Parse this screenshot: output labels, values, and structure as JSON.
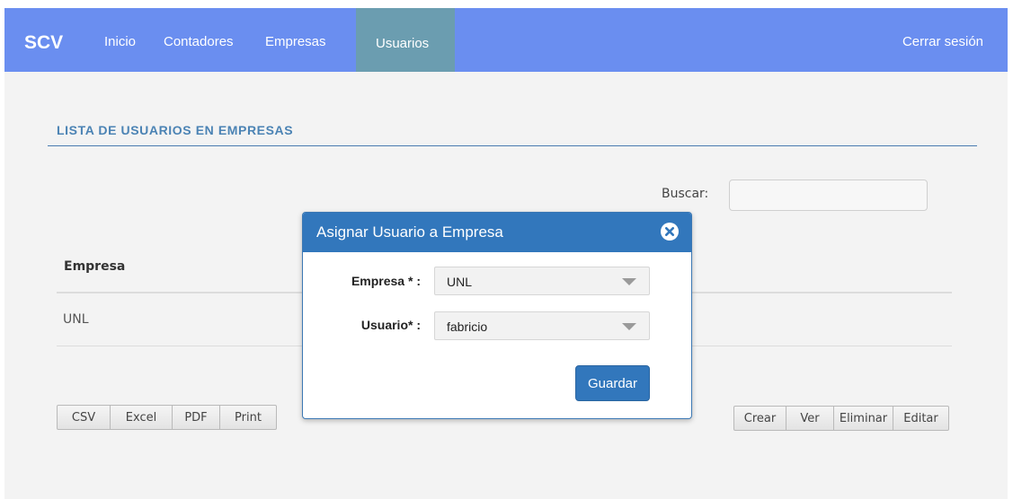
{
  "navbar": {
    "brand": "SCV",
    "links": [
      "Inicio",
      "Contadores",
      "Empresas"
    ],
    "active": "Usuarios",
    "logout": "Cerrar sesión"
  },
  "page": {
    "title": "LISTA DE USUARIOS EN EMPRESAS",
    "search_label": "Buscar:",
    "search_value": ""
  },
  "table": {
    "columns": [
      "Empresa"
    ],
    "rows": [
      [
        "UNL"
      ]
    ]
  },
  "export_buttons": [
    "CSV",
    "Excel",
    "PDF",
    "Print"
  ],
  "action_buttons": [
    "Crear",
    "Ver",
    "Eliminar",
    "Editar"
  ],
  "modal": {
    "title": "Asignar Usuario a Empresa",
    "empresa_label": "Empresa * :",
    "empresa_value": "UNL",
    "usuario_label": "Usuario* :",
    "usuario_value": "fabricio",
    "save_label": "Guardar"
  },
  "colors": {
    "navbar": "#6a8ef0",
    "nav_active": "#6b9db0",
    "accent": "#3277bc",
    "background": "#f3f3f3"
  }
}
